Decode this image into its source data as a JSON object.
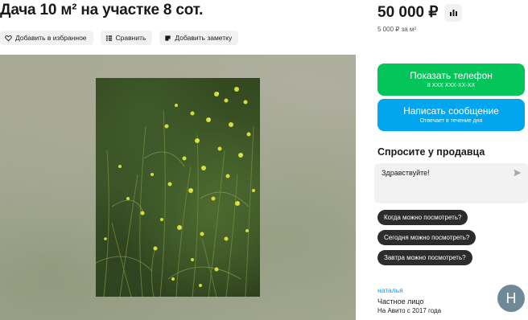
{
  "listing": {
    "title": "Дача 10 м² на участке 8 сот."
  },
  "actions": [
    {
      "label": "Добавить в избранное",
      "icon": "heart-icon"
    },
    {
      "label": "Сравнить",
      "icon": "compare-icon"
    },
    {
      "label": "Добавить заметку",
      "icon": "note-icon"
    }
  ],
  "price": {
    "value": "50 000 ₽",
    "per_unit": "5 000 ₽ за м²",
    "stats_icon": "bar-chart-icon"
  },
  "contact": {
    "phone_label": "Показать телефон",
    "phone_masked": "8 XXX XXX-XX-XX",
    "message_label": "Написать сообщение",
    "message_sub": "Отвечает в течение дня"
  },
  "ask": {
    "title": "Спросите у продавца",
    "input_value": "Здравствуйте!",
    "send_icon": "send-icon",
    "quick_questions": [
      "Когда можно посмотреть?",
      "Сегодня можно посмотреть?",
      "Завтра можно посмотреть?"
    ]
  },
  "seller": {
    "name": "наталья",
    "type": "Частное лицо",
    "since": "На Авито с 2017 года",
    "avatar_letter": "Н"
  },
  "colors": {
    "green": "#04c55a",
    "blue": "#02a6ef",
    "link": "#0099f7",
    "chip": "#2c2c2c",
    "avatar": "#6f8a96"
  }
}
